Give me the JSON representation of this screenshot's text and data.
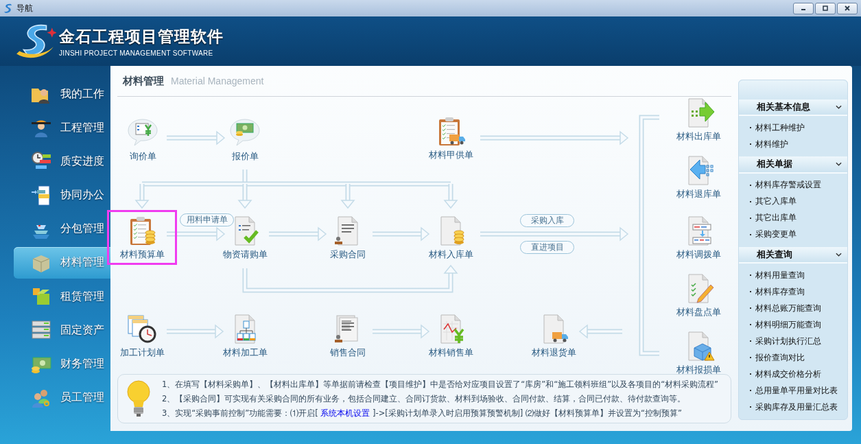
{
  "window": {
    "title": "导航"
  },
  "header": {
    "title": "金石工程项目管理软件",
    "subtitle": "JINSHI PROJECT MANAGEMENT SOFTWARE"
  },
  "nav": {
    "items": [
      {
        "label": "我的工作",
        "selected": false
      },
      {
        "label": "工程管理",
        "selected": false
      },
      {
        "label": "质安进度",
        "selected": false
      },
      {
        "label": "协同办公",
        "selected": false
      },
      {
        "label": "分包管理",
        "selected": false
      },
      {
        "label": "材料管理",
        "selected": true
      },
      {
        "label": "租赁管理",
        "selected": false
      },
      {
        "label": "固定资产",
        "selected": false
      },
      {
        "label": "财务管理",
        "selected": false
      },
      {
        "label": "员工管理",
        "selected": false
      }
    ]
  },
  "panel": {
    "title": "材料管理",
    "subtitle": "Material Management"
  },
  "flow": {
    "nodes": [
      {
        "label": "询价单",
        "highlighted": false
      },
      {
        "label": "报价单",
        "highlighted": false
      },
      {
        "label": "材料甲供单",
        "highlighted": false
      },
      {
        "label": "材料预算单",
        "highlighted": true
      },
      {
        "label": "物资请购单",
        "highlighted": false
      },
      {
        "label": "采购合同",
        "highlighted": false
      },
      {
        "label": "材料入库单",
        "highlighted": false
      },
      {
        "label": "加工计划单",
        "highlighted": false
      },
      {
        "label": "材料加工单",
        "highlighted": false
      },
      {
        "label": "销售合同",
        "highlighted": false
      },
      {
        "label": "材料销售单",
        "highlighted": false
      },
      {
        "label": "材料退货单",
        "highlighted": false
      },
      {
        "label": "材料出库单",
        "highlighted": false
      },
      {
        "label": "材料退库单",
        "highlighted": false
      },
      {
        "label": "材料调拨单",
        "highlighted": false
      },
      {
        "label": "材料盘点单",
        "highlighted": false
      },
      {
        "label": "材料报损单",
        "highlighted": false
      }
    ],
    "pills": [
      "用料申请单",
      "采购入库",
      "直进项目"
    ]
  },
  "tips": [
    {
      "text": "1、在填写【材料采购单】、【材料出库单】等单据前请检查【项目维护】中是否给对应项目设置了“库房”和“施工领料班组”以及各项目的“材料采购流程”"
    },
    {
      "text": "2、【采购合同】可实现有关采购合同的所有业务，包括合同建立、合同订货款、材料到场验收、合同付款、结算，合同已付款、待付款查询等。"
    },
    {
      "text": "3、实现“采购事前控制”功能需要：⑴开启[ ",
      "link": "系统本机设置",
      "text_after": " ]->[采购计划单录入时启用预算预警机制]  ⑵做好【材料预算单】并设置为“控制预算”"
    }
  ],
  "sidebar": {
    "sections": [
      {
        "title": "相关基本信息",
        "expanded": true,
        "items": [
          "材料工种维护",
          "材料维护"
        ]
      },
      {
        "title": "相关单据",
        "expanded": true,
        "items": [
          "材料库存警戒设置",
          "其它入库单",
          "其它出库单",
          "采购变更单"
        ]
      },
      {
        "title": "相关查询",
        "expanded": true,
        "items": [
          "材料用量查询",
          "材料库存查询",
          "材料总账万能查询",
          "材料明细万能查询",
          "采购计划执行汇总",
          "报价查询对比",
          "材料成交价格分析",
          "总用量单平用量对比表",
          "采购库存及用量汇总表"
        ]
      }
    ]
  }
}
